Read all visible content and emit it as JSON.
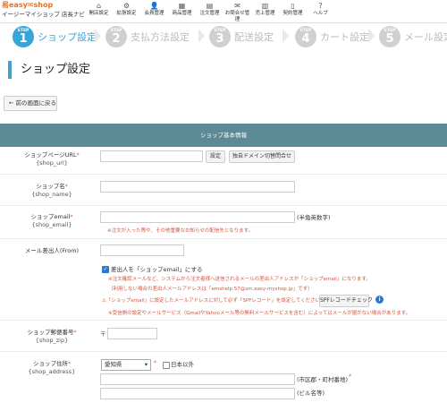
{
  "brand": {
    "logo": "易easy✉shop",
    "sub": "イージーマイショップ 店長ナビ"
  },
  "nav": [
    {
      "icon": "⌂",
      "label": "開店設定"
    },
    {
      "icon": "⚙",
      "label": "拡張設定"
    },
    {
      "icon": "👤",
      "label": "会員管理"
    },
    {
      "icon": "▦",
      "label": "商品管理"
    },
    {
      "icon": "▤",
      "label": "注文管理"
    },
    {
      "icon": "✉",
      "label": "お問合せ管理"
    },
    {
      "icon": "▥",
      "label": "売上管理"
    },
    {
      "icon": "▯",
      "label": "契約管理"
    },
    {
      "icon": "?",
      "label": "ヘルプ"
    }
  ],
  "steps": [
    {
      "tag": "STEP",
      "num": "1",
      "label": "ショップ設定"
    },
    {
      "tag": "STEP",
      "num": "2",
      "label": "支払方法設定"
    },
    {
      "tag": "STEP",
      "num": "3",
      "label": "配送設定"
    },
    {
      "tag": "STEP",
      "num": "4",
      "label": "カート設定"
    },
    {
      "tag": "STEP",
      "num": "5",
      "label": "メール設定"
    }
  ],
  "page_title": "ショップ設定",
  "back_button": "前の画面に戻る",
  "section_title": "ショップ基本情報",
  "form": {
    "url": {
      "label": "ショップページURL",
      "key": "{shop_url}",
      "btn_set": "設定",
      "btn_domain": "独自ドメイン切替問合せ"
    },
    "name": {
      "label": "ショップ名",
      "key": "{shop_name}"
    },
    "email": {
      "label": "ショップemail",
      "key": "{shop_email}",
      "suffix": "(半角英数字)",
      "note": "※注文が入った際や、その他重要なお知らせの配信先となります。"
    },
    "from": {
      "label": "メール差出人(From)",
      "checkbox": "差出人を「ショップemail」にする",
      "note1": "※注文確認メールなど、システムから注文者様へ送信されるメールの差出人アドレスが「ショップemail」になります。",
      "note2": "（利用しない場合の差出人メールアドレスは「emshelp.57@sm.easy-myshop.jp」です）",
      "note3": "⚠「ショップemail」に設定したメールアドレスに対して必ず「SPFレコード」を設定してください。",
      "spf_button": "SPFレコードチェック",
      "note4": "※受信側の設定やメールサービス（GmailやYahooメール等の無料メールサービスを含む）によってはメールが届かない場合があります。"
    },
    "zip": {
      "label": "ショップ郵便番号",
      "key": "{shop_zip}",
      "prefix": "〒"
    },
    "address": {
      "label": "ショップ住所",
      "key": "{shop_address}",
      "pref_value": "愛知県",
      "abroad": "日本以外",
      "suffix1": "(市区郡・町村番地)",
      "suffix2": "(ビル名等)"
    }
  }
}
